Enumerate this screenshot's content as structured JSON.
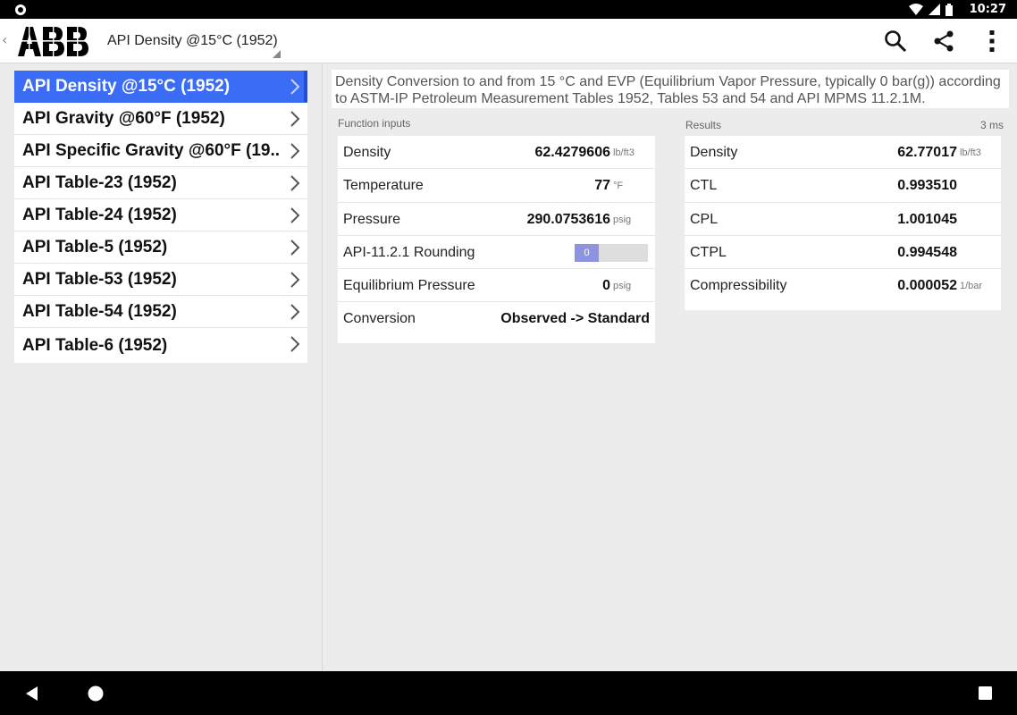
{
  "status_bar": {
    "time": "10:27",
    "icons": [
      "wifi-icon",
      "signal-icon",
      "battery-icon"
    ]
  },
  "app_bar": {
    "logo_text": "ABB",
    "selected_function": "API Density @15°C (1952)",
    "actions": [
      "search-icon",
      "share-icon",
      "more-vert-icon"
    ]
  },
  "sidebar": {
    "items": [
      {
        "label": "API Density @15°C (1952)",
        "selected": true
      },
      {
        "label": "API Gravity @60°F (1952)"
      },
      {
        "label": "API Specific Gravity @60°F (19.."
      },
      {
        "label": "API Table-23 (1952)"
      },
      {
        "label": "API Table-24 (1952)"
      },
      {
        "label": "API Table-5 (1952)"
      },
      {
        "label": "API Table-53 (1952)"
      },
      {
        "label": "API Table-54 (1952)"
      },
      {
        "label": "API Table-6 (1952)"
      }
    ],
    "colors": {
      "selected_bg": "#3a6cf6"
    }
  },
  "description": "Density Conversion to and from 15 °C and EVP (Equilibrium Vapor Pressure, typically 0 bar(g)) according to ASTM-IP Petroleum Measurement Tables 1952, Tables 53 and 54 and API MPMS 11.2.1M.",
  "inputs": {
    "section_label": "Function inputs",
    "rows": [
      {
        "name": "Density",
        "value": "62.4279606",
        "unit": "lb/ft3"
      },
      {
        "name": "Temperature",
        "value": "77",
        "unit": "°F"
      },
      {
        "name": "Pressure",
        "value": "290.0753616",
        "unit": "psig"
      },
      {
        "name": "API-11.2.1 Rounding",
        "value": "0",
        "unit": ""
      },
      {
        "name": "Equilibrium Pressure",
        "value": "0",
        "unit": "psig"
      },
      {
        "name": "Conversion",
        "value": "Observed -> Standard",
        "unit": ""
      }
    ]
  },
  "results": {
    "section_label": "Results",
    "elapsed": "3 ms",
    "rows": [
      {
        "name": "Density",
        "value": "62.77017",
        "unit": "lb/ft3"
      },
      {
        "name": "CTL",
        "value": "0.993510",
        "unit": ""
      },
      {
        "name": "CPL",
        "value": "1.001045",
        "unit": ""
      },
      {
        "name": "CTPL",
        "value": "0.994548",
        "unit": ""
      },
      {
        "name": "Compressibility",
        "value": "0.000052",
        "unit": "1/bar"
      }
    ]
  },
  "nav_bar": {
    "buttons": [
      "back-icon",
      "home-icon",
      "recents-icon"
    ]
  }
}
